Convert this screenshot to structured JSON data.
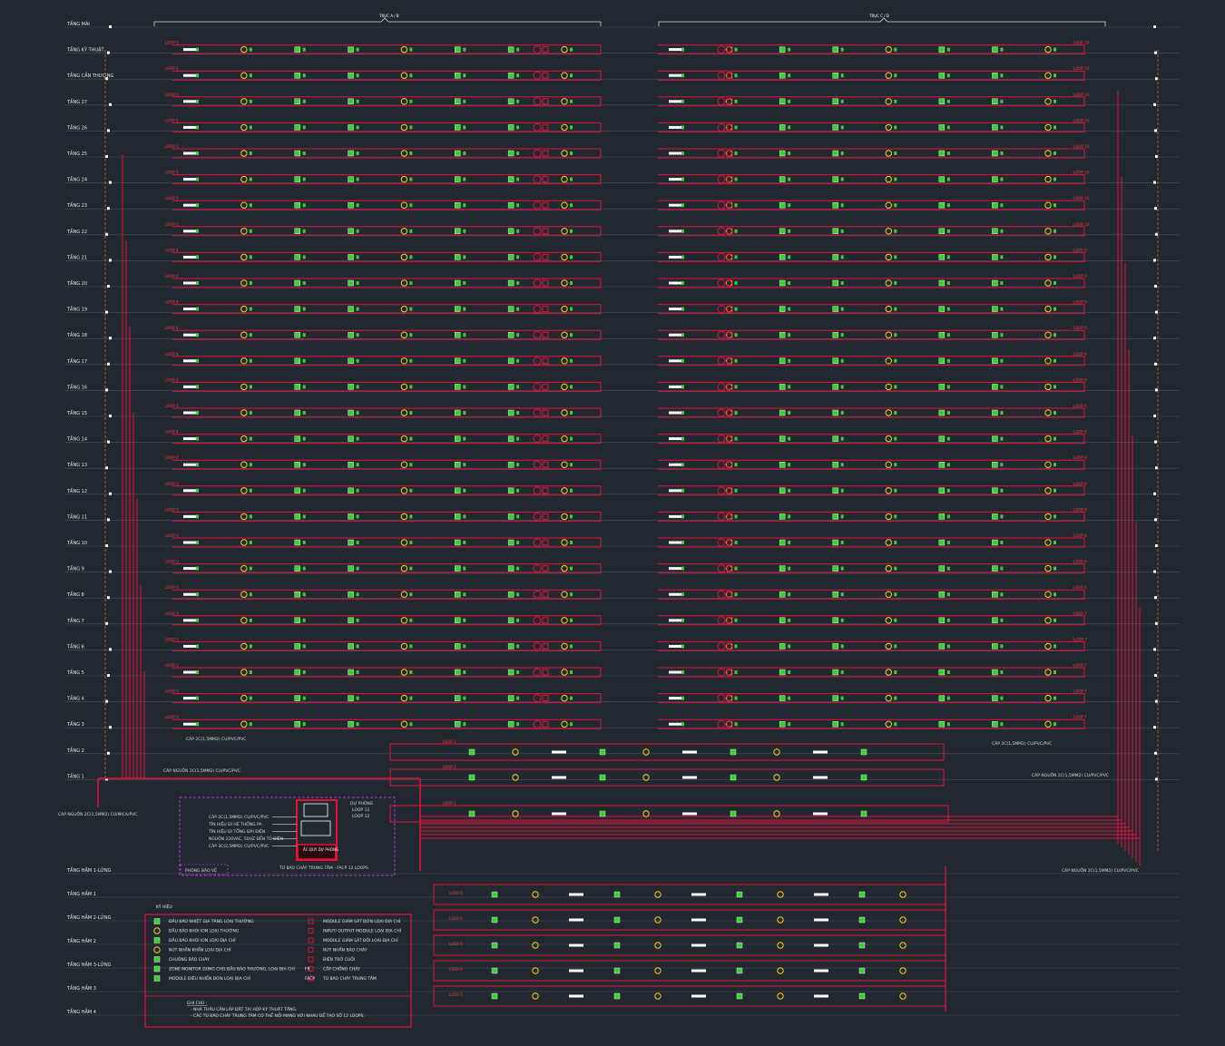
{
  "floors": [
    "TẦNG MÁI",
    "TẦNG KỸ THUẬT",
    "TẦNG CẦN THƯỢNG",
    "TẦNG 27",
    "TẦNG 26",
    "TẦNG 25",
    "TẦNG 24",
    "TẦNG 23",
    "TẦNG 22",
    "TẦNG 21",
    "TẦNG 20",
    "TẦNG 19",
    "TẦNG 18",
    "TẦNG 17",
    "TẦNG 16",
    "TẦNG 15",
    "TẦNG 14",
    "TẦNG 13",
    "TẦNG 12",
    "TẦNG 11",
    "TẦNG 10",
    "TẦNG 9",
    "TẦNG 8",
    "TẦNG 7",
    "TẦNG 6",
    "TẦNG 5",
    "TẦNG 4",
    "TẦNG 3",
    "TẦNG 2",
    "TẦNG 1"
  ],
  "basement_floors": [
    "TẦNG HẦM 1-LỬNG",
    "TẦNG HẦM 1",
    "TẦNG HẦM 2-LỬNG",
    "TẦNG HẦM 2",
    "TẦNG HẦM 3-LỬNG",
    "TẦNG HẦM 3",
    "TẦNG HẦM 4"
  ],
  "left_loops": [
    "LOOP 5",
    "LOOP 5",
    "LOOP 5",
    "LOOP 5",
    "LOOP 5",
    "LOOP 5",
    "LOOP 5",
    "LOOP 5",
    "LOOP 4",
    "LOOP 4",
    "LOOP 4",
    "LOOP 4",
    "LOOP 4",
    "LOOP 4",
    "LOOP 4",
    "LOOP 4",
    "LOOP 4",
    "LOOP 3",
    "LOOP 3",
    "LOOP 3",
    "LOOP 3",
    "LOOP 3",
    "LOOP 3",
    "LOOP 3",
    "LOOP 3",
    "LOOP 3",
    "LOOP 3"
  ],
  "right_loops": [
    "LOOP 10",
    "LOOP 10",
    "LOOP 10",
    "LOOP 10",
    "LOOP 10",
    "LOOP 10",
    "LOOP 10",
    "LOOP 10",
    "LOOP 9",
    "LOOP 9",
    "LOOP 9",
    "LOOP 9",
    "LOOP 9",
    "LOOP 9",
    "LOOP 9",
    "LOOP 8",
    "LOOP 8",
    "LOOP 8",
    "LOOP 8",
    "LOOP 8",
    "LOOP 8",
    "LOOP 8",
    "LOOP 7",
    "LOOP 7",
    "LOOP 7",
    "LOOP 7",
    "LOOP 7"
  ],
  "top_left_bracket": "TRỤC A / B",
  "top_right_bracket": "TRỤC C / D",
  "mid_loops": [
    "LOOP 2",
    "LOOP 2",
    "LOOP 1"
  ],
  "basement_loops": [
    "LOOP 6",
    "LOOP 6",
    "LOOP 6",
    "LOOP 6",
    "LOOP 6"
  ],
  "cables": {
    "left_riser": "CÁP NGUỒN 2C(1,5MM2) CU/PVC/PVC",
    "right_riser": "CÁP NGUỒN 2C(1,5MM2) CU/PVC/PVC",
    "left_loop": "CÁP 2C(1,5MM2) CU/PVC/PVC",
    "right_loop": "CÁP 2C(1,5MM2) CU/PVC/PVC",
    "left_bottom": "CÁP NGUỒN 2C(1,5MM2) CU/MICA/PVC",
    "right_bottom": "CÁP NGUỒN 2C(1,5MM2) CU/PVC/PVC"
  },
  "panel": {
    "room": "PHÒNG BẢO VỆ",
    "title": "TỦ BÁO CHÁY TRUNG TÂM - FACP 12 LOOPS",
    "notes_loops": [
      "DỰ PHÒNG",
      "LOOP 11",
      "LOOP 12"
    ],
    "inputs": [
      "CÁP 2C(1,5MM2) CU/PVC/PVC",
      "TÍN HIỆU ĐI HỆ THỐNG PA",
      "TÍN HIỆU ĐI TỔNG ĐÀI ĐIỆN",
      "NGUỒN 220VAC, 50HZ ĐẾN TỦ ĐIỆN",
      "CÁP 3C(2,5MM2) CU/PVC/PVC"
    ],
    "sub_label": "ẮC QUY DỰ PHÒNG"
  },
  "legend": {
    "title": "KÝ HIỆU",
    "left_items": [
      "ĐẦU BÁO NHIỆT GIA TĂNG LOẠI THƯỜNG",
      "ĐẦU BÁO KHÓI ION LOẠI THƯỜNG",
      "ĐẦU BÁO KHÓI ION LOẠI ĐỊA CHỈ",
      "NÚT NHẤN KHẨN LOẠI ĐỊA CHỈ",
      "CHUÔNG BÁO CHÁY",
      "ZONE MONITOR DÙNG CHO ĐẦU BÁO THƯỜNG, LOẠI ĐỊA CHỈ",
      "MODULE ĐIỀU KHIỂN ĐƠN LOẠI ĐỊA CHỈ"
    ],
    "right_items": [
      "MODULE GIÁM SÁT ĐƠN LOẠI ĐỊA CHỈ",
      "INPUT/ OUTPUT MODULE LOẠI ĐỊA CHỈ",
      "MODULE GIÁM SÁT ĐÔI LOẠI ĐỊA CHỈ",
      "NÚT NHẤN BÁO CHÁY",
      "ĐIỆN TRỞ CUỐI",
      "CẤP CHỐNG CHÁY",
      "TỦ BÁO CHÁY TRUNG TÂM"
    ],
    "right_codes": [
      "",
      "",
      "",
      "",
      "",
      "FR",
      "FACP"
    ],
    "notes_title": "GHI CHÚ :",
    "notes": [
      "- NHÀ THẦU CẦN LẮP ĐẶT TẠI HỘP KỸ THUẬT TẦNG.",
      "- CÁC TỦ BÁO CHÁY TRUNG TÂM CÓ THỂ NỐI MẠNG VỚI NHAU ĐỂ TẠO SỐ 12 LOOPS."
    ]
  },
  "colors": {
    "bg": "#212830",
    "wire": "#e8103a",
    "device": "#39d12f",
    "device_alt": "#ffd21a",
    "text": "#e6e6e6",
    "gridline": "#4a525c",
    "panel_border": "#b53bd6"
  }
}
